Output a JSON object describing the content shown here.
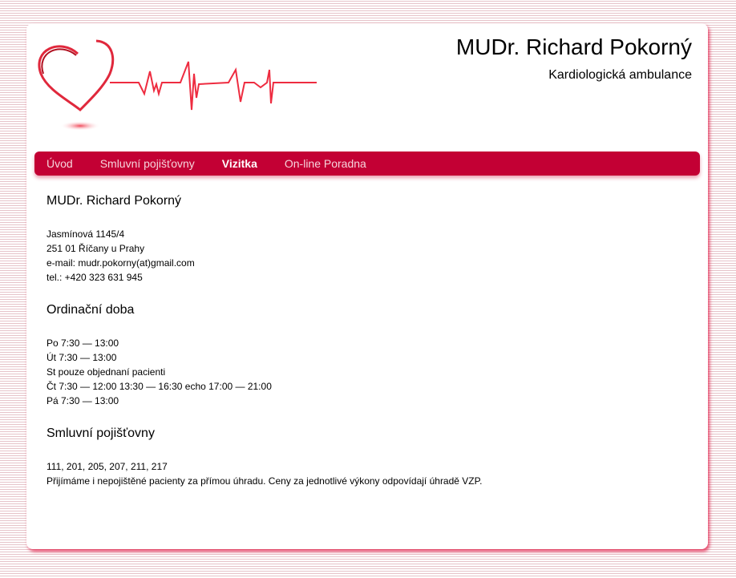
{
  "header": {
    "title": "MUDr. Richard Pokorný",
    "subtitle": "Kardiologická ambulance",
    "logo_icon": "heart-ekg-icon"
  },
  "nav": {
    "items": [
      {
        "label": "Úvod"
      },
      {
        "label": "Smluvní pojišťovny"
      },
      {
        "label": "Vizitka",
        "active": true
      },
      {
        "label": "On-line Poradna"
      }
    ]
  },
  "contact": {
    "heading": "MUDr. Richard Pokorný",
    "lines": [
      "Jasmínová 1145/4",
      "251 01 Říčany u Prahy",
      "e-mail: mudr.pokorny(at)gmail.com",
      "tel.: +420 323 631 945"
    ]
  },
  "hours": {
    "heading": "Ordinační doba",
    "lines": [
      "Po 7:30 — 13:00",
      "Út 7:30 — 13:00",
      "St pouze objednaní pacienti",
      "Čt 7:30 — 12:00 13:30 — 16:30 echo 17:00 — 21:00",
      "Pá 7:30 — 13:00"
    ]
  },
  "insurance": {
    "heading": "Smluvní pojišťovny",
    "lines": [
      "111, 201, 205, 207, 211, 217",
      "Přijímáme i nepojištěné pacienty za přímou úhradu. Ceny za jednotlivé výkony odpovídají úhradě VZP."
    ]
  },
  "colors": {
    "accent": "#c30034"
  }
}
